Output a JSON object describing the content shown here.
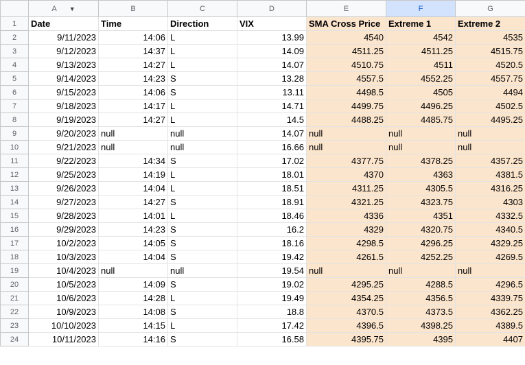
{
  "columns": [
    "A",
    "B",
    "C",
    "D",
    "E",
    "F",
    "G"
  ],
  "header_row": {
    "num": "1",
    "cells": [
      "Date",
      "Time",
      "Direction",
      "VIX",
      "SMA Cross Price",
      "Extreme 1",
      "Extreme 2"
    ]
  },
  "rows": [
    {
      "num": "2",
      "cells": [
        "9/11/2023",
        "14:06",
        "L",
        "13.99",
        "4540",
        "4542",
        "4535"
      ]
    },
    {
      "num": "3",
      "cells": [
        "9/12/2023",
        "14:37",
        "L",
        "14.09",
        "4511.25",
        "4511.25",
        "4515.75"
      ]
    },
    {
      "num": "4",
      "cells": [
        "9/13/2023",
        "14:27",
        "L",
        "14.07",
        "4510.75",
        "4511",
        "4520.5"
      ]
    },
    {
      "num": "5",
      "cells": [
        "9/14/2023",
        "14:23",
        "S",
        "13.28",
        "4557.5",
        "4552.25",
        "4557.75"
      ]
    },
    {
      "num": "6",
      "cells": [
        "9/15/2023",
        "14:06",
        "S",
        "13.11",
        "4498.5",
        "4505",
        "4494"
      ]
    },
    {
      "num": "7",
      "cells": [
        "9/18/2023",
        "14:17",
        "L",
        "14.71",
        "4499.75",
        "4496.25",
        "4502.5"
      ]
    },
    {
      "num": "8",
      "cells": [
        "9/19/2023",
        "14:27",
        "L",
        "14.5",
        "4488.25",
        "4485.75",
        "4495.25"
      ]
    },
    {
      "num": "9",
      "cells": [
        "9/20/2023",
        "null",
        "null",
        "14.07",
        "null",
        "null",
        "null"
      ]
    },
    {
      "num": "10",
      "cells": [
        "9/21/2023",
        "null",
        "null",
        "16.66",
        "null",
        "null",
        "null"
      ]
    },
    {
      "num": "11",
      "cells": [
        "9/22/2023",
        "14:34",
        "S",
        "17.02",
        "4377.75",
        "4378.25",
        "4357.25"
      ]
    },
    {
      "num": "12",
      "cells": [
        "9/25/2023",
        "14:19",
        "L",
        "18.01",
        "4370",
        "4363",
        "4381.5"
      ]
    },
    {
      "num": "13",
      "cells": [
        "9/26/2023",
        "14:04",
        "L",
        "18.51",
        "4311.25",
        "4305.5",
        "4316.25"
      ]
    },
    {
      "num": "14",
      "cells": [
        "9/27/2023",
        "14:27",
        "S",
        "18.91",
        "4321.25",
        "4323.75",
        "4303"
      ]
    },
    {
      "num": "15",
      "cells": [
        "9/28/2023",
        "14:01",
        "L",
        "18.46",
        "4336",
        "4351",
        "4332.5"
      ]
    },
    {
      "num": "16",
      "cells": [
        "9/29/2023",
        "14:23",
        "S",
        "16.2",
        "4329",
        "4320.75",
        "4340.5"
      ]
    },
    {
      "num": "17",
      "cells": [
        "10/2/2023",
        "14:05",
        "S",
        "18.16",
        "4298.5",
        "4296.25",
        "4329.25"
      ]
    },
    {
      "num": "18",
      "cells": [
        "10/3/2023",
        "14:04",
        "S",
        "19.42",
        "4261.5",
        "4252.25",
        "4269.5"
      ]
    },
    {
      "num": "19",
      "cells": [
        "10/4/2023",
        "null",
        "null",
        "19.54",
        "null",
        "null",
        "null"
      ]
    },
    {
      "num": "20",
      "cells": [
        "10/5/2023",
        "14:09",
        "S",
        "19.02",
        "4295.25",
        "4288.5",
        "4296.5"
      ]
    },
    {
      "num": "21",
      "cells": [
        "10/6/2023",
        "14:28",
        "L",
        "19.49",
        "4354.25",
        "4356.5",
        "4339.75"
      ]
    },
    {
      "num": "22",
      "cells": [
        "10/9/2023",
        "14:08",
        "S",
        "18.8",
        "4370.5",
        "4373.5",
        "4362.25"
      ]
    },
    {
      "num": "23",
      "cells": [
        "10/10/2023",
        "14:15",
        "L",
        "17.42",
        "4396.5",
        "4398.25",
        "4389.5"
      ]
    },
    {
      "num": "24",
      "cells": [
        "10/11/2023",
        "14:16",
        "S",
        "16.58",
        "4395.75",
        "4395",
        "4407"
      ]
    }
  ],
  "colors": {
    "highlight": "#fce5cd",
    "selected_header": "#d3e3fd"
  },
  "icons": {
    "column_a_menu": "dropdown-caret-icon"
  }
}
